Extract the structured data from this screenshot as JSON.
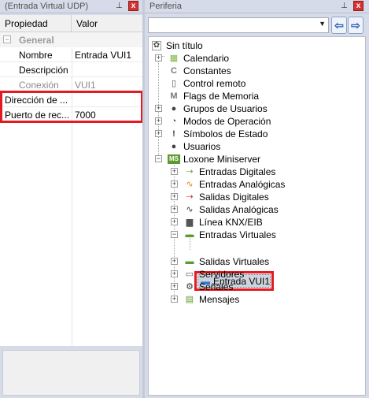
{
  "left_panel": {
    "title": "(Entrada Virtual UDP)",
    "pin_glyph": "⊥",
    "close_glyph": "x",
    "columns": {
      "property": "Propiedad",
      "value": "Valor"
    },
    "category": {
      "label": "General",
      "toggle": "−"
    },
    "rows": [
      {
        "key": "Nombre",
        "value": "Entrada VUI1",
        "muted": false
      },
      {
        "key": "Descripción",
        "value": "",
        "muted": false
      },
      {
        "key": "Conexión",
        "value": "VUI1",
        "muted": true
      },
      {
        "key": "Dirección de ...",
        "value": "",
        "muted": false
      },
      {
        "key": "Puerto de rec...",
        "value": "7000",
        "muted": false
      }
    ]
  },
  "right_panel": {
    "title": "Periferia",
    "pin_glyph": "⊥",
    "close_glyph": "x",
    "combo": {
      "value": "",
      "arrow": "▼"
    },
    "back_glyph": "⇦",
    "forward_glyph": "⇨",
    "tree": {
      "root": "Sin título",
      "items": [
        {
          "label": "Calendario",
          "icon": "calendar-icon",
          "glyph": "▦",
          "color": "#7cb342"
        },
        {
          "label": "Constantes",
          "icon": "constant-icon",
          "glyph": "C",
          "color": "#777777"
        },
        {
          "label": "Control remoto",
          "icon": "remote-icon",
          "glyph": "▯",
          "color": "#555555"
        },
        {
          "label": "Flags de Memoria",
          "icon": "memory-flag-icon",
          "glyph": "M",
          "color": "#777777"
        },
        {
          "label": "Grupos de Usuarios",
          "icon": "user-group-icon",
          "glyph": "●",
          "color": "#444444"
        },
        {
          "label": "Modos de Operación",
          "icon": "operating-mode-icon",
          "glyph": "◔",
          "color": "#444444"
        },
        {
          "label": "Símbolos de Estado",
          "icon": "status-symbol-icon",
          "glyph": "!",
          "color": "#444444"
        },
        {
          "label": "Usuarios",
          "icon": "user-icon",
          "glyph": "●",
          "color": "#444444"
        },
        {
          "label": "Loxone Miniserver",
          "icon": "miniserver-icon",
          "glyph": "MS",
          "color": "#5a9a2e"
        }
      ],
      "miniserver_children": [
        {
          "label": "Entradas Digitales",
          "icon": "digital-input-icon",
          "glyph": "⇢",
          "color": "#6aa33a"
        },
        {
          "label": "Entradas Analógicas",
          "icon": "analog-input-icon",
          "glyph": "∿",
          "color": "#e07b00"
        },
        {
          "label": "Salidas Digitales",
          "icon": "digital-output-icon",
          "glyph": "⇢",
          "color": "#d32f2f"
        },
        {
          "label": "Salidas Analógicas",
          "icon": "analog-output-icon",
          "glyph": "∿",
          "color": "#333333"
        },
        {
          "label": "Línea KNX/EIB",
          "icon": "knx-icon",
          "glyph": "▆",
          "color": "#555555"
        },
        {
          "label": "Entradas Virtuales",
          "icon": "virtual-input-icon",
          "glyph": "▬",
          "color": "#5a9a2e"
        },
        {
          "label": "Entrada VUI1",
          "icon": "virtual-input-item-icon",
          "glyph": "▬",
          "color": "#2d7bd6"
        },
        {
          "label": "Salidas Virtuales",
          "icon": "virtual-output-icon",
          "glyph": "▬",
          "color": "#5a9a2e"
        },
        {
          "label": "Servidores",
          "icon": "server-icon",
          "glyph": "▭",
          "color": "#555555"
        },
        {
          "label": "Señales",
          "icon": "signal-icon",
          "glyph": "⚙",
          "color": "#333333"
        },
        {
          "label": "Mensajes",
          "icon": "message-icon",
          "glyph": "▤",
          "color": "#5a9a2e"
        }
      ]
    }
  }
}
